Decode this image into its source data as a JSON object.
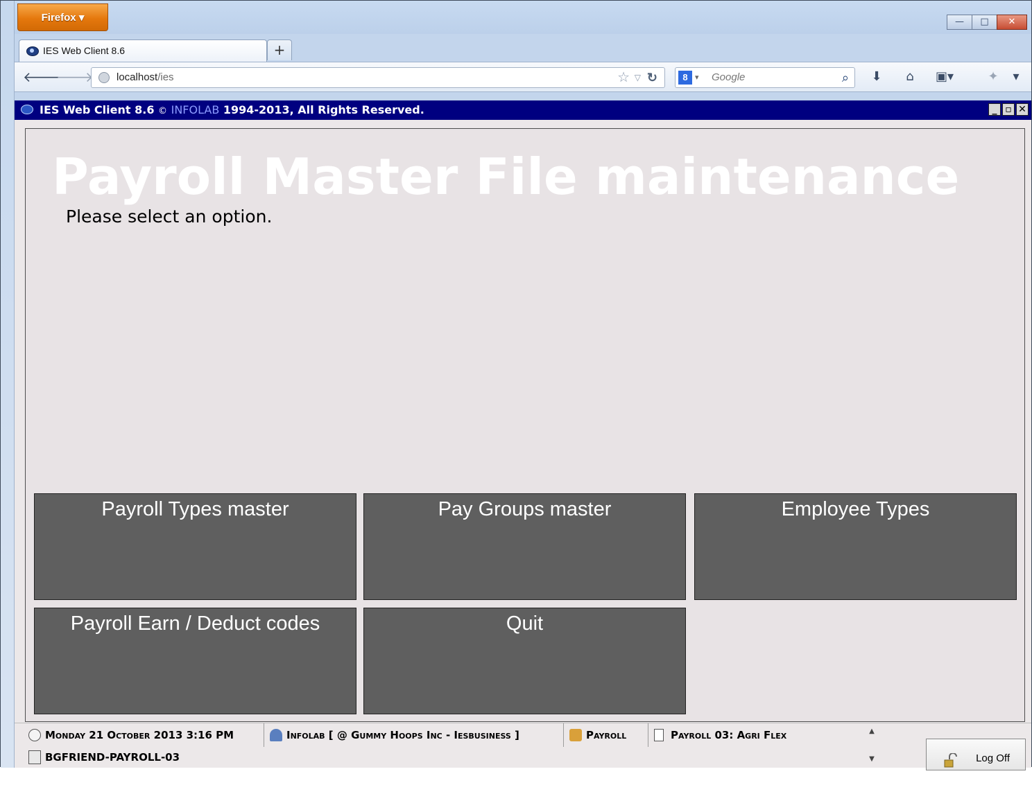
{
  "browser": {
    "menu_button": "Firefox ▾",
    "tab_title": "IES Web Client 8.6",
    "new_tab": "+",
    "url_host": "localhost",
    "url_path": "/ies",
    "search_engine_icon": "8",
    "search_placeholder": "Google",
    "win_controls": {
      "minimize": "▭",
      "maximize": "▢",
      "close": "✕"
    }
  },
  "app": {
    "title": "IES Web Client 8.6",
    "copyright_symbol": "©",
    "brand": "INFOLAB",
    "rights": "1994-2013, All Rights Reserved.",
    "controls": [
      "_",
      "▫",
      "✕"
    ]
  },
  "main": {
    "heading": "Payroll Master File maintenance",
    "prompt": "Please select an option.",
    "options": [
      {
        "label": "Payroll Types master"
      },
      {
        "label": "Pay Groups master"
      },
      {
        "label": "Employee Types"
      },
      {
        "label": "Payroll Earn / Deduct codes"
      },
      {
        "label": "Quit"
      }
    ]
  },
  "status": {
    "datetime": "Monday 21 October 2013 3:16 PM",
    "user": "Infolab [ @ Gummy Hoops Inc - Iesbusiness ]",
    "module": "Payroll",
    "document": "Payroll 03: Agri Flex",
    "session": "BGFRIEND-PAYROLL-03",
    "logoff": "Log Off"
  }
}
